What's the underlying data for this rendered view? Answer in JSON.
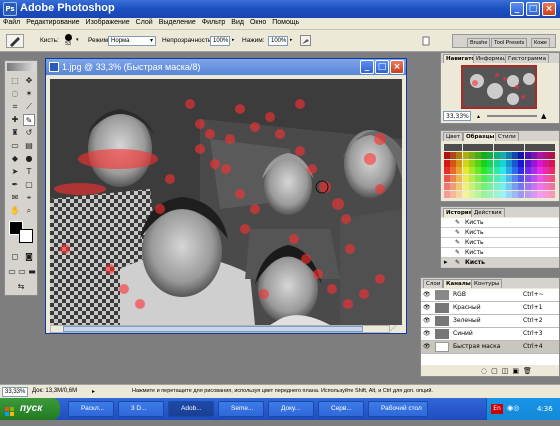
{
  "window": {
    "title": "Adobe Photoshop",
    "logo": "Ps"
  },
  "menu": [
    "Файл",
    "Редактирование",
    "Изображение",
    "Слой",
    "Выделение",
    "Фильтр",
    "Вид",
    "Окно",
    "Помощь"
  ],
  "options": {
    "brush_label": "Кисть:",
    "brush_size": "53",
    "mode_label": "Режим:",
    "mode_value": "Норма",
    "opacity_label": "Непрозрачность:",
    "opacity_value": "100%",
    "flow_label": "Нажим:",
    "flow_value": "100%",
    "palette_tabs": [
      "Brushe",
      "Tool Presets",
      "Коже"
    ]
  },
  "document": {
    "title": "1.jpg @ 33,3% (Быстрая маска/8)"
  },
  "navigator": {
    "tabs": [
      "Навигатор",
      "Информация",
      "Гистограмма"
    ],
    "zoom": "33,33%"
  },
  "swatches": {
    "tabs": [
      "Цвет",
      "Образцы",
      "Стили"
    ]
  },
  "history": {
    "tabs": [
      "История",
      "Действия"
    ],
    "items": [
      "Кисть",
      "Кисть",
      "Кисть",
      "Кисть",
      "Кисть"
    ]
  },
  "channels": {
    "tabs": [
      "Слои",
      "Каналы",
      "Контуры"
    ],
    "items": [
      {
        "name": "RGB",
        "shortcut": "Ctrl+~"
      },
      {
        "name": "Красный",
        "shortcut": "Ctrl+1"
      },
      {
        "name": "Зеленый",
        "shortcut": "Ctrl+2"
      },
      {
        "name": "Синий",
        "shortcut": "Ctrl+3"
      },
      {
        "name": "Быстрая маска",
        "shortcut": "Ctrl+4"
      }
    ]
  },
  "status": {
    "zoom": "33,33%",
    "doc": "Док: 13,3M/0,6M",
    "hint": "Нажмите и перетащите для рисования, используя цвет переднего плана. Используйте Shift, Alt, и Ctrl для доп. опций."
  },
  "taskbar": {
    "start": "пуск",
    "items": [
      "Раскл...",
      "3 D...",
      "Adob...",
      "Seme...",
      "Доку...",
      "Серв...",
      "Рабочий стол"
    ],
    "lang": "En",
    "time": "4:36"
  },
  "colors": {
    "title": "#1c4fc0",
    "mask": "#ff3030",
    "task": "#2a5bd0"
  },
  "icons": [
    "brush-icon",
    "marquee-icon",
    "lasso-icon",
    "crop-icon",
    "eraser-icon",
    "gradient-icon",
    "text-icon",
    "pen-icon",
    "hand-icon",
    "zoom-icon",
    "eye-icon"
  ]
}
